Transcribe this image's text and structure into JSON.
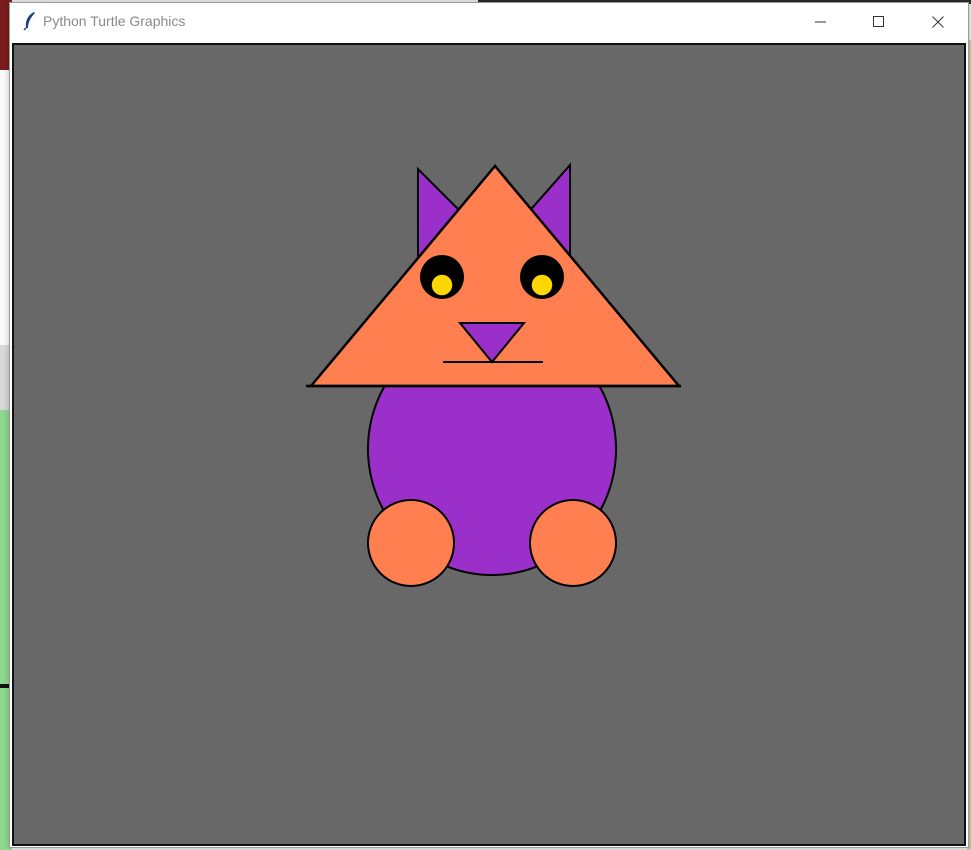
{
  "window": {
    "title": "Python Turtle Graphics",
    "title_icon": "feather-icon",
    "controls": {
      "minimize": "minimize-icon",
      "maximize": "maximize-icon",
      "close": "close-icon"
    }
  },
  "canvas": {
    "background": "#686868",
    "drawing": "cat",
    "colors": {
      "ears": "#9a2fc9",
      "head": "#ff7f50",
      "body": "#9a2fc9",
      "feet": "#ff7f50",
      "nose": "#9a2fc9",
      "pupil_outer": "#000000",
      "pupil_inner": "#ffd700",
      "outline": "#000000"
    }
  }
}
